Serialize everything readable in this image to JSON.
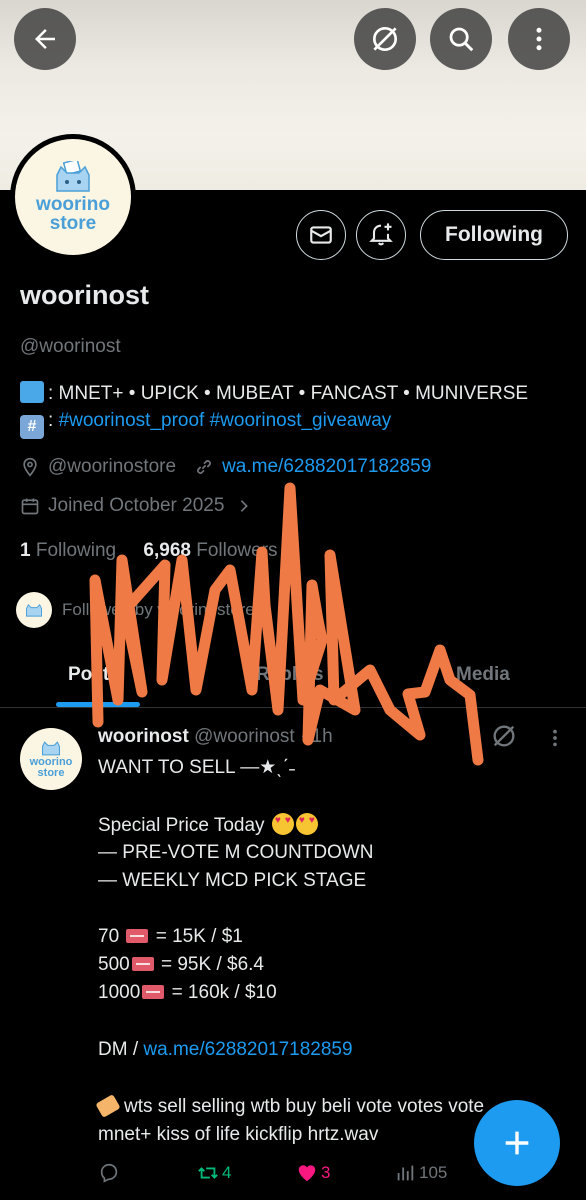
{
  "profile": {
    "avatar_text_line1": "woorino",
    "avatar_text_line2": "store",
    "name": "woorinost",
    "handle": "@woorinost",
    "bio_line1": ": MNET+ • UPICK • MUBEAT • FANCAST • MUNIVERSE",
    "bio_line2_prefix": ":",
    "bio_line2_tags": "#woorinost_proof #woorinost_giveaway",
    "location": "@woorinostore",
    "website": "wa.me/62882017182859",
    "joined": "Joined October 2025",
    "following_count": "1",
    "following_label": "Following",
    "followers_count": "6,968",
    "followers_label": "Followers",
    "followed_by": "Followed by woorinostore",
    "follow_button_label": "Following"
  },
  "tabs": [
    "Posts",
    "Replies",
    "Media"
  ],
  "post": {
    "author": "woorinost",
    "handle": "@woorinost",
    "time": "· 1h",
    "lines": {
      "l1": "WANT TO SELL —★ˎˊ˗",
      "l2": "Special Price Today",
      "l3": "— PRE-VOTE M COUNTDOWN",
      "l4": "— WEEKLY MCD PICK STAGE",
      "l5a": "70",
      "l5b": "= 15K / $1",
      "l6a": "500",
      "l6b": "= 95K / $6.4",
      "l7a": "1000",
      "l7b": "= 160k / $10",
      "l8a": "DM /",
      "l8b": "wa.me/62882017182859",
      "l9": "wts sell selling wtb buy beli vote votes vote",
      "l10": "mnet+ kiss of life kickflip hrtz.wav"
    },
    "retweets": "4",
    "likes": "3",
    "views": "105"
  },
  "colors": {
    "accent": "#1d9bf0",
    "like": "#f91880",
    "retweet": "#00ba7c",
    "scribble": "#f07a45"
  }
}
